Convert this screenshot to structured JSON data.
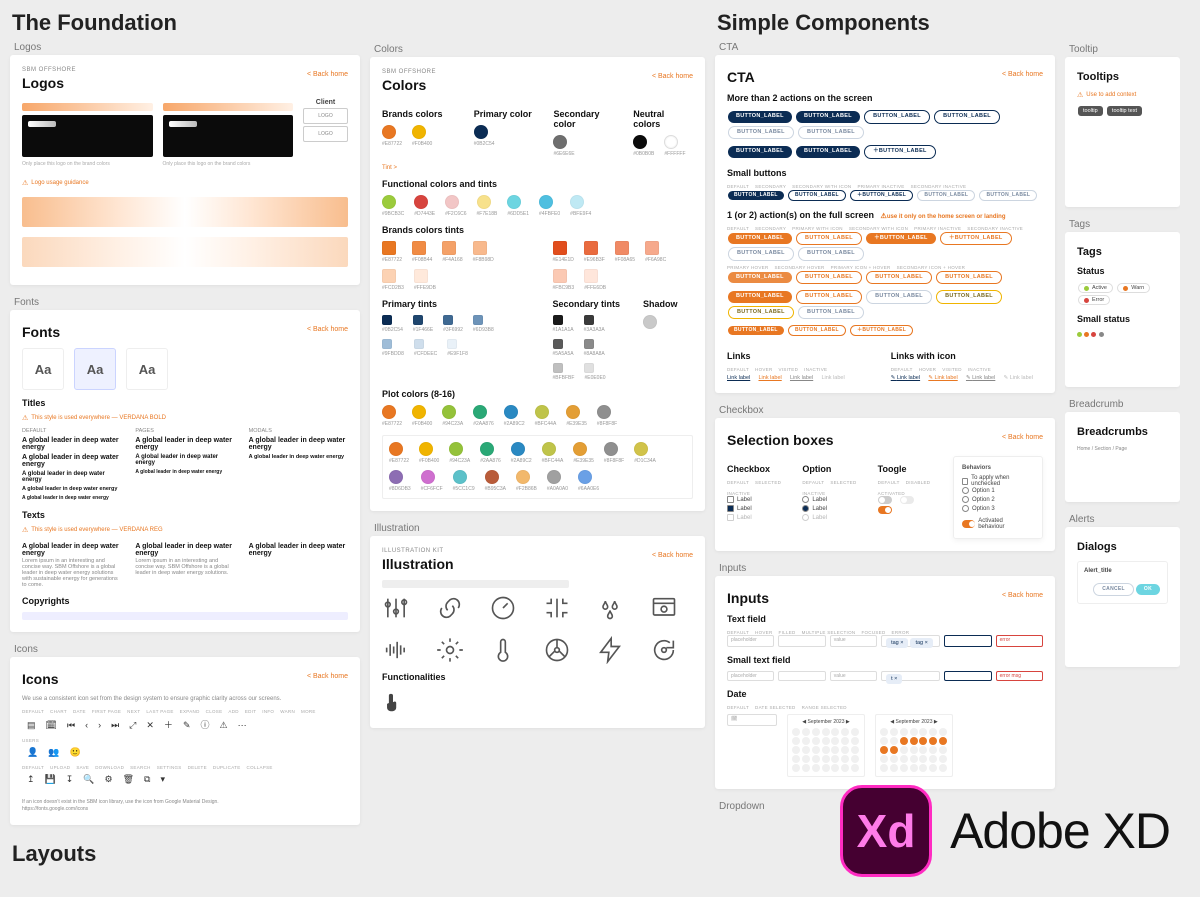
{
  "section1_title": "The Foundation",
  "section2_title": "Simple Components",
  "layouts_title": "Layouts",
  "back_label": "< Back home",
  "foundation": {
    "logos": {
      "label": "Logos",
      "title": "Logos",
      "client": "Client",
      "note1": "Only place this logo on the brand colors",
      "note2": "Only place this logo on the brand colors",
      "warn": "Logo usage guidance"
    },
    "fonts": {
      "label": "Fonts",
      "title": "Fonts",
      "aa": "Aa",
      "titles": "Titles",
      "texts": "Texts",
      "copyrights": "Copyrights",
      "sample": "A global leader in deep water energy"
    },
    "icons": {
      "label": "Icons",
      "title": "Icons",
      "intro": "We use a consistent icon set from the design system to ensure graphic clarity across our screens."
    },
    "colors": {
      "label": "Colors",
      "title": "Colors",
      "brands": "Brands colors",
      "primary": "Primary color",
      "secondary": "Secondary color",
      "neutral": "Neutral colors",
      "tint_link": "Tint  >",
      "func": "Functional colors and tints",
      "brandtints": "Brands colors tints",
      "ptints": "Primary tints",
      "stints": "Secondary tints",
      "shadow": "Shadow",
      "plot": "Plot colors (8-16)"
    },
    "illus": {
      "label": "Illustration",
      "title": "Illustration",
      "func": "Functionalities"
    }
  },
  "components": {
    "cta": {
      "label": "CTA",
      "title": "CTA",
      "more2": "More than 2 actions on the screen",
      "small": "Small buttons",
      "full": "1 (or 2) action(s) on the full screen",
      "links": "Links",
      "links_icon": "Links with icon",
      "btn_label": "BUTTON_LABEL",
      "link_label": "Link label"
    },
    "checkbox": {
      "label": "Checkbox",
      "title": "Selection boxes",
      "cb": "Checkbox",
      "opt": "Option",
      "tog": "Toogle",
      "beh": "Behaviors",
      "item": "Label"
    },
    "inputs": {
      "label": "Inputs",
      "title": "Inputs",
      "tf": "Text field",
      "stf": "Small text field",
      "date": "Date"
    },
    "dropdown": {
      "label": "Dropdown"
    },
    "tooltip": {
      "label": "Tooltip",
      "title": "Tooltips"
    },
    "tags": {
      "label": "Tags",
      "title": "Tags",
      "status": "Status",
      "smallstatus": "Small status"
    },
    "bread": {
      "label": "Breadcrumb",
      "title": "Breadcrumbs"
    },
    "alerts": {
      "label": "Alerts",
      "title": "Dialogs"
    }
  },
  "palette": {
    "brand": [
      "#e87722",
      "#f0b400"
    ],
    "primary": "#0b2c54",
    "secondary": "#6e6e6e",
    "neutral": [
      "#0b0b0b",
      "#ffffff"
    ],
    "func": [
      "#9bcb3c",
      "#d7443e",
      "#f2c6c6",
      "#f7e18b",
      "#6dd5e1",
      "#4fbfe0",
      "#bfe9f4"
    ],
    "brandtints1": [
      "#e87722",
      "#f08b44",
      "#f4a168",
      "#f8b98d",
      "#fcd2b3",
      "#ffe9db"
    ],
    "brandtints2": [
      "#e14e1d",
      "#e96b3f",
      "#f08a65",
      "#f6a98c",
      "#fbc9b3",
      "#ffe6db"
    ],
    "ptints": [
      "#0b2c54",
      "#1f466e",
      "#3f6992",
      "#6d93b8",
      "#9fbdd8",
      "#cfdeec",
      "#e9f1f8"
    ],
    "stints": [
      "#1a1a1a",
      "#3a3a3a",
      "#5a5a5a",
      "#8a8a8a",
      "#bfbfbf",
      "#e0e0e0"
    ],
    "shadow": "#c9c9c9",
    "plot": [
      "#e87722",
      "#f0b400",
      "#94c23a",
      "#2aa876",
      "#2a89c2",
      "#bfc44a",
      "#e39e35",
      "#8f8f8f",
      "#d1c34a",
      "#8d6db3",
      "#cf6fcf",
      "#5cc1c9",
      "#b95c3a",
      "#f2b86b",
      "#a0a0a0",
      "#6aa0e6"
    ]
  },
  "adobe_xd": "Adobe XD"
}
